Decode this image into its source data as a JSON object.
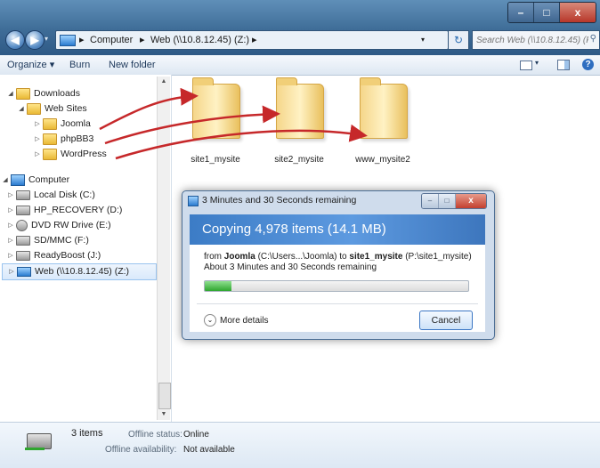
{
  "window": {
    "minimize": "–",
    "maximize": "□",
    "close": "x"
  },
  "nav": {
    "back": "◀",
    "forward": "▶"
  },
  "address": {
    "segments": [
      "Computer",
      "Web (\\\\10.8.12.45) (Z:)"
    ],
    "search_placeholder": "Search Web (\\\\10.8.12.45) (P:)"
  },
  "toolbar": {
    "organize": "Organize ▾",
    "burn": "Burn",
    "new_folder": "New folder"
  },
  "tree": {
    "downloads": "Downloads",
    "web_sites": "Web Sites",
    "joomla": "Joomla",
    "phpbb3": "phpBB3",
    "wordpress": "WordPress",
    "computer": "Computer",
    "local_disk": "Local Disk (C:)",
    "hp_recovery": "HP_RECOVERY (D:)",
    "dvd": "DVD RW Drive (E:)",
    "sdmmc": "SD/MMC (F:)",
    "readyboost": "ReadyBoost (J:)",
    "web": "Web (\\\\10.8.12.45) (Z:)"
  },
  "folders": [
    "site1_mysite",
    "site2_mysite",
    "www_mysite2"
  ],
  "dialog": {
    "title": "3 Minutes and 30 Seconds remaining",
    "heading": "Copying 4,978 items (14.1 MB)",
    "from_label": "from",
    "from_name": "Joomla",
    "from_path": "(C:\\Users...\\Joomla) to",
    "to_name": "site1_mysite",
    "to_path": "(P:\\site1_mysite)",
    "remaining": "About 3 Minutes and 30 Seconds remaining",
    "progress": 0.1,
    "more_details": "More details",
    "cancel": "Cancel"
  },
  "details": {
    "count": "3 items",
    "offline_status_label": "Offline status:",
    "offline_status_value": "Online",
    "offline_avail_label": "Offline availability:",
    "offline_avail_value": "Not available"
  },
  "colors": {
    "arrow": "#c6282a",
    "progress": "#2fa62f"
  }
}
